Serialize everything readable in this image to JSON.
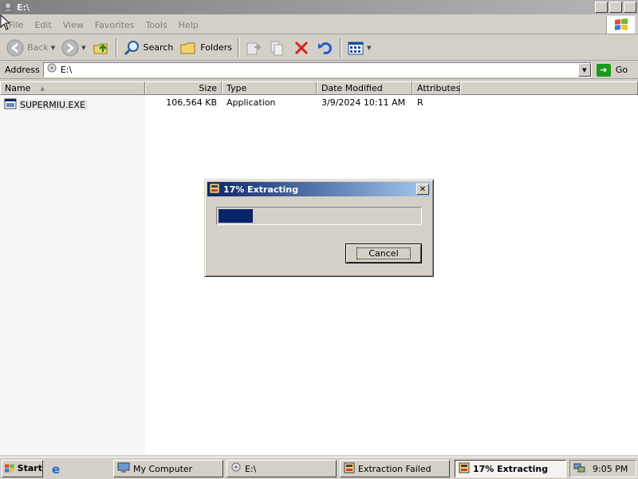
{
  "window": {
    "title": "E:\\",
    "min_label": "_",
    "max_label": "❐",
    "close_label": "✕"
  },
  "menu": {
    "items": [
      {
        "label": "File"
      },
      {
        "label": "Edit"
      },
      {
        "label": "View"
      },
      {
        "label": "Favorites"
      },
      {
        "label": "Tools"
      },
      {
        "label": "Help"
      }
    ]
  },
  "toolbar": {
    "back_label": "Back",
    "search_label": "Search",
    "folders_label": "Folders"
  },
  "address": {
    "label": "Address",
    "value": "E:\\",
    "go_label": "Go"
  },
  "filelist": {
    "columns": [
      "Name",
      "Size",
      "Type",
      "Date Modified",
      "Attributes"
    ],
    "rows": [
      {
        "name": "SUPERMIU.EXE",
        "size": "106,564 KB",
        "type": "Application",
        "date": "3/9/2024 10:11 AM",
        "attributes": "R"
      }
    ]
  },
  "dialog": {
    "title": "17% Extracting",
    "progress": 0.17,
    "cancel_label": "Cancel"
  },
  "taskbar": {
    "start_label": "Start",
    "tasks": [
      {
        "label": "My Computer"
      },
      {
        "label": "E:\\"
      },
      {
        "label": "Extraction Failed"
      },
      {
        "label": "17% Extracting"
      }
    ],
    "clock": "9:05 PM"
  },
  "colors": {
    "dialog_title": "#0a246a",
    "progress_fill": "#0a246a",
    "inactive_title": "#808080"
  }
}
